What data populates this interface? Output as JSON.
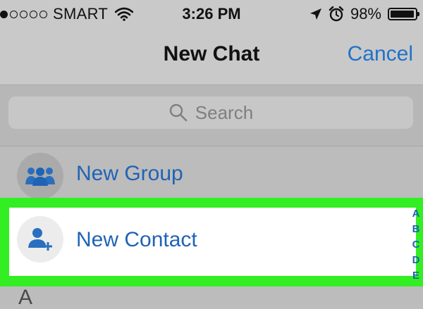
{
  "status_bar": {
    "signal_dots_filled": 1,
    "signal_dots_total": 5,
    "carrier": "SMART",
    "time": "3:26 PM",
    "battery": "98%",
    "battery_level": 0.98,
    "icons": [
      "wifi-icon",
      "location-arrow-icon",
      "alarm-icon",
      "battery-icon"
    ]
  },
  "nav": {
    "title": "New Chat",
    "cancel_label": "Cancel"
  },
  "search": {
    "placeholder": "Search",
    "icon": "search-icon"
  },
  "rows": [
    {
      "label": "New Group",
      "icon": "group-icon"
    },
    {
      "label": "New Contact",
      "icon": "add-contact-icon"
    }
  ],
  "index_letters": [
    "A",
    "B",
    "C",
    "D",
    "E"
  ],
  "section_header": "A",
  "colors": {
    "accent": "#1f72c9",
    "highlight": "#33ee22"
  }
}
